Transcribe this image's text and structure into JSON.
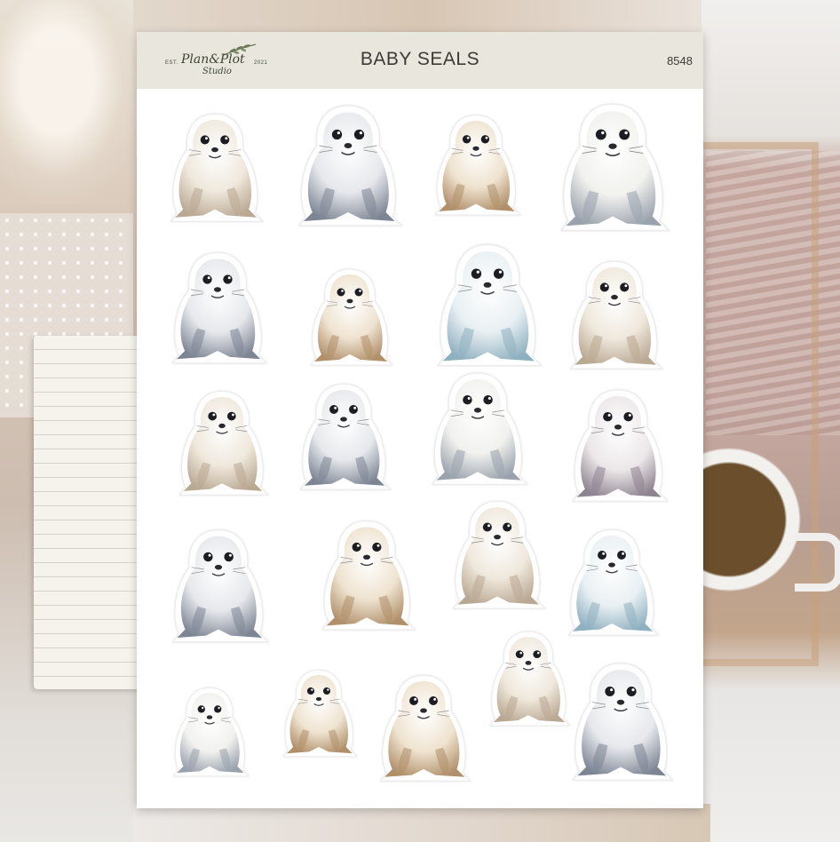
{
  "sheet": {
    "title": "BABY SEALS",
    "code": "8548"
  },
  "brand": {
    "est": "EST.",
    "name": "Plan&Plot",
    "sub": "Studio",
    "year": "2021"
  },
  "stickers": [
    {
      "name": "baby-seal",
      "tone": "cream"
    },
    {
      "name": "baby-seal",
      "tone": "grey"
    },
    {
      "name": "baby-seal",
      "tone": "tan"
    },
    {
      "name": "baby-seal",
      "tone": "white"
    },
    {
      "name": "baby-seal",
      "tone": "grey"
    },
    {
      "name": "baby-seal",
      "tone": "tan"
    },
    {
      "name": "baby-seal",
      "tone": "blue"
    },
    {
      "name": "baby-seal",
      "tone": "cream"
    },
    {
      "name": "baby-seal",
      "tone": "cream"
    },
    {
      "name": "baby-seal",
      "tone": "grey"
    },
    {
      "name": "baby-seal",
      "tone": "white"
    },
    {
      "name": "baby-seal",
      "tone": "mauve"
    },
    {
      "name": "baby-seal",
      "tone": "grey"
    },
    {
      "name": "baby-seal",
      "tone": "tan"
    },
    {
      "name": "baby-seal",
      "tone": "cream"
    },
    {
      "name": "baby-seal",
      "tone": "blue"
    },
    {
      "name": "baby-seal",
      "tone": "white"
    },
    {
      "name": "baby-seal",
      "tone": "tan"
    },
    {
      "name": "baby-seal",
      "tone": "tan"
    },
    {
      "name": "baby-seal",
      "tone": "cream"
    },
    {
      "name": "baby-seal",
      "tone": "grey"
    }
  ],
  "tones": {
    "cream": {
      "body": "#efe8dc",
      "shade": "#b9a892"
    },
    "grey": {
      "body": "#e6e8ec",
      "shade": "#7d8594"
    },
    "tan": {
      "body": "#efe3d0",
      "shade": "#b08f6a"
    },
    "white": {
      "body": "#f1f1ee",
      "shade": "#9aa2ad"
    },
    "blue": {
      "body": "#e9f0f3",
      "shade": "#8fb0c0"
    },
    "mauve": {
      "body": "#ece7e8",
      "shade": "#8e8391"
    }
  }
}
